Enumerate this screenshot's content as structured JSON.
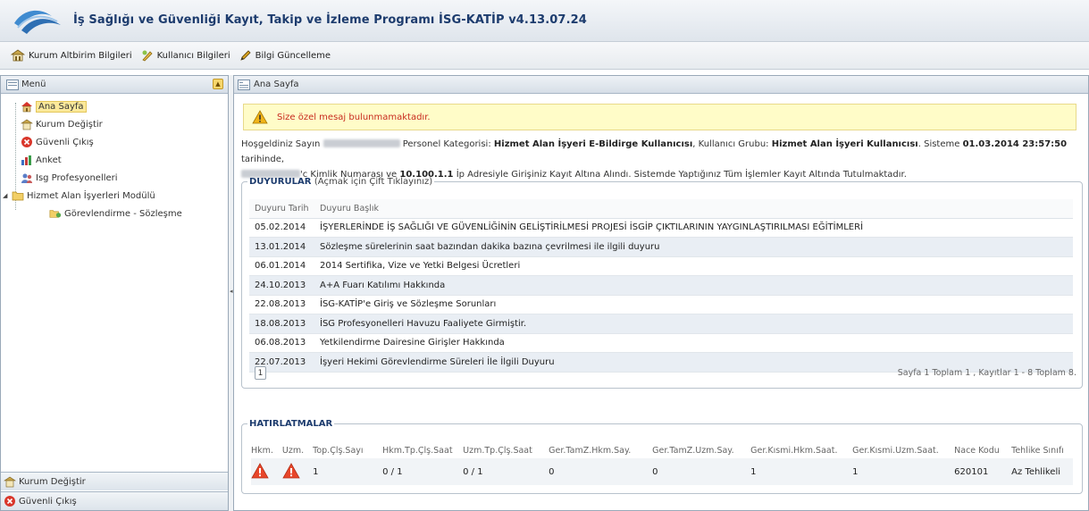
{
  "app": {
    "title": "İş Sağlığı ve Güvenliği Kayıt, Takip ve İzleme Programı İSG-KATİP v4.13.07.24"
  },
  "toolbar": {
    "items": [
      {
        "label": "Kurum Altbirim Bilgileri",
        "icon": "building-icon"
      },
      {
        "label": "Kullanıcı Bilgileri",
        "icon": "user-edit-icon"
      },
      {
        "label": "Bilgi Güncelleme",
        "icon": "pencil-icon"
      }
    ]
  },
  "sidebar": {
    "title": "Menü",
    "items": [
      {
        "label": "Ana Sayfa",
        "icon": "home-icon",
        "selected": true
      },
      {
        "label": "Kurum Değiştir",
        "icon": "building-icon"
      },
      {
        "label": "Güvenli Çıkış",
        "icon": "exit-icon"
      },
      {
        "label": "Anket",
        "icon": "chart-icon"
      },
      {
        "label": "Isg Profesyonelleri",
        "icon": "people-icon"
      },
      {
        "label": "Hizmet Alan İşyerleri Modülü",
        "icon": "folder-icon"
      },
      {
        "label": "Görevlendirme - Sözleşme",
        "icon": "assign-icon",
        "child": true
      }
    ],
    "footer": [
      {
        "label": "Kurum Değiştir",
        "icon": "building-icon"
      },
      {
        "label": "Güvenli Çıkış",
        "icon": "exit-icon"
      }
    ]
  },
  "main": {
    "tab_title": "Ana Sayfa",
    "alert": "Size özel mesaj bulunmamaktadır.",
    "welcome": {
      "greeting": "Hoşgeldiniz Sayın",
      "category_label": "Personel Kategorisi:",
      "category": "Hizmet Alan İşyeri E-Bildirge Kullanıcısı",
      "group_label": ", Kullanıcı Grubu:",
      "group": "Hizmet Alan İşyeri Kullanıcısı",
      "login_prefix": ". Sisteme",
      "login_time": "01.03.2014 23:57:50",
      "login_suffix": "tarihinde,",
      "id_text": "'c Kimlik Numarası ve",
      "ip": "10.100.1.1",
      "ip_suffix": "İp Adresiyle Girişiniz Kayıt Altına Alındı. Sistemde Yaptığınız Tüm İşlemler Kayıt Altında Tutulmaktadır."
    },
    "announcements": {
      "legend": "DUYURULAR",
      "legend_sub": "(Açmak için Çift Tıklayınız)",
      "col_date": "Duyuru Tarih",
      "col_title": "Duyuru Başlık",
      "rows": [
        {
          "date": "05.02.2014",
          "title": "İŞYERLERİNDE İŞ SAĞLIĞI VE GÜVENLİĞİNİN GELİŞTİRİLMESİ PROJESİ İSGİP ÇIKTILARININ YAYGINLAŞTIRILMASI EĞİTİMLERİ"
        },
        {
          "date": "13.01.2014",
          "title": "Sözleşme sürelerinin saat bazından dakika bazına çevrilmesi ile ilgili duyuru"
        },
        {
          "date": "06.01.2014",
          "title": "2014 Sertifika, Vize ve Yetki Belgesi Ücretleri"
        },
        {
          "date": "24.10.2013",
          "title": "A+A Fuarı Katılımı Hakkında"
        },
        {
          "date": "22.08.2013",
          "title": "İSG-KATİP'e Giriş ve Sözleşme Sorunları"
        },
        {
          "date": "18.08.2013",
          "title": "İSG Profesyonelleri Havuzu Faaliyete Girmiştir."
        },
        {
          "date": "06.08.2013",
          "title": "Yetkilendirme Dairesine Girişler Hakkında"
        },
        {
          "date": "22.07.2013",
          "title": "İşyeri Hekimi Görevlendirme Süreleri İle İlgili Duyuru"
        }
      ],
      "page_button": "1",
      "page_info": "Sayfa 1 Toplam 1 , Kayıtlar 1 - 8 Toplam 8."
    },
    "reminders": {
      "legend": "HATIRLATMALAR",
      "columns": [
        "Hkm.",
        "Uzm.",
        "Top.Çlş.Sayı",
        "Hkm.Tp.Çlş.Saat",
        "Uzm.Tp.Çlş.Saat",
        "Ger.TamZ.Hkm.Say.",
        "Ger.TamZ.Uzm.Say.",
        "Ger.Kısmi.Hkm.Saat.",
        "Ger.Kısmi.Uzm.Saat.",
        "Nace Kodu",
        "Tehlike Sınıfı"
      ],
      "row": [
        "1",
        "0 / 1",
        "0 / 1",
        "0",
        "0",
        "1",
        "1",
        "620101",
        "Az Tehlikeli"
      ]
    }
  },
  "colors": {
    "title": "#1d3c6e",
    "alert_text": "#c82a1e",
    "alert_bg": "#fffcc8",
    "warning": "#e8462a"
  }
}
